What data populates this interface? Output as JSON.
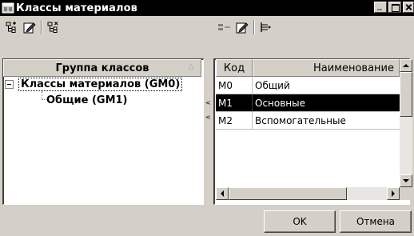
{
  "window": {
    "title": "Классы материалов"
  },
  "tree": {
    "header": "Группа классов",
    "root_label": "Классы материалов (GM0)",
    "child_label": "Общие (GM1)"
  },
  "grid": {
    "columns": [
      "Код",
      "Наименование"
    ],
    "rows": [
      {
        "code": "M0",
        "name": "Общий"
      },
      {
        "code": "M1",
        "name": "Основные",
        "selected": true
      },
      {
        "code": "M2",
        "name": "Вспомогательные"
      }
    ]
  },
  "buttons": {
    "ok": "OK",
    "cancel": "Отмена"
  },
  "icons": {
    "left_toolbar": [
      "add-tree-node-icon",
      "edit-icon",
      "delete-tree-node-icon"
    ],
    "right_toolbar": [
      "add-row-icon",
      "edit-icon",
      "move-row-icon"
    ]
  },
  "colors": {
    "selection": "#000000",
    "face": "#d4d0c8"
  }
}
